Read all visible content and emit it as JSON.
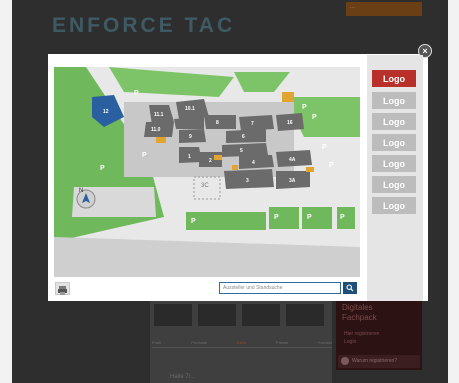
{
  "header": {
    "logo_text": "ENFORCE TAC",
    "orange_button_label": "...",
    "accent": "#6a3f16"
  },
  "behind": {
    "tabs": [
      "Profil",
      "Produkte",
      "Infos",
      "Presse",
      "Kontakt"
    ],
    "active_tab_index": 2,
    "hall_text": "Halle 7/...",
    "dark_panel": {
      "title_line1": "Digitales",
      "title_line2": "Fachpack",
      "item1": "Hier registrieren",
      "item2": "Login",
      "register_label": "Warum registrieren?"
    }
  },
  "modal": {
    "close_label": "×",
    "logos": [
      "Logo",
      "Logo",
      "Logo",
      "Logo",
      "Logo",
      "Logo",
      "Logo"
    ],
    "active_logo_index": 0,
    "search": {
      "placeholder": "Aussteller und Standsuche",
      "button_icon": "magnifier-icon"
    },
    "print_icon": "printer-icon",
    "colors": {
      "active_logo": "#b92f29",
      "inactive_logo": "#bcbcbc",
      "search_button": "#1f4f79",
      "sidebar_bg": "#e5e5e5"
    }
  },
  "map": {
    "halls": [
      "12",
      "11.1",
      "11.0",
      "10.1",
      "9",
      "8",
      "7",
      "6",
      "5",
      "4",
      "4A",
      "3",
      "3A",
      "2",
      "1",
      "3C"
    ],
    "parking": [
      "P",
      "P",
      "P",
      "P",
      "P",
      "P",
      "P",
      "P",
      "P",
      "P",
      "P"
    ],
    "compass": "N"
  }
}
